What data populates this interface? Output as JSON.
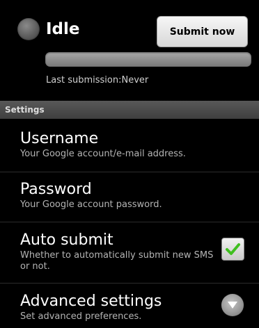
{
  "status": {
    "label": "Idle",
    "indicator_icon": "status-dot-icon",
    "indicator_color": "#5d5d5d"
  },
  "actions": {
    "submit_label": "Submit now"
  },
  "progress": {
    "fraction": 0
  },
  "last_submission": "Last submission:Never",
  "settings": {
    "section_title": "Settings",
    "username": {
      "title": "Username",
      "summary": "Your Google account/e-mail address."
    },
    "password": {
      "title": "Password",
      "summary": "Your Google account password."
    },
    "auto_submit": {
      "title": "Auto submit",
      "summary": "Whether to automatically submit new SMS or not.",
      "checked": true,
      "check_icon": "checkmark-icon",
      "check_color": "#3fbf1f"
    },
    "advanced": {
      "title": "Advanced settings",
      "summary": "Set advanced preferences.",
      "icon": "chevron-down-icon"
    }
  }
}
